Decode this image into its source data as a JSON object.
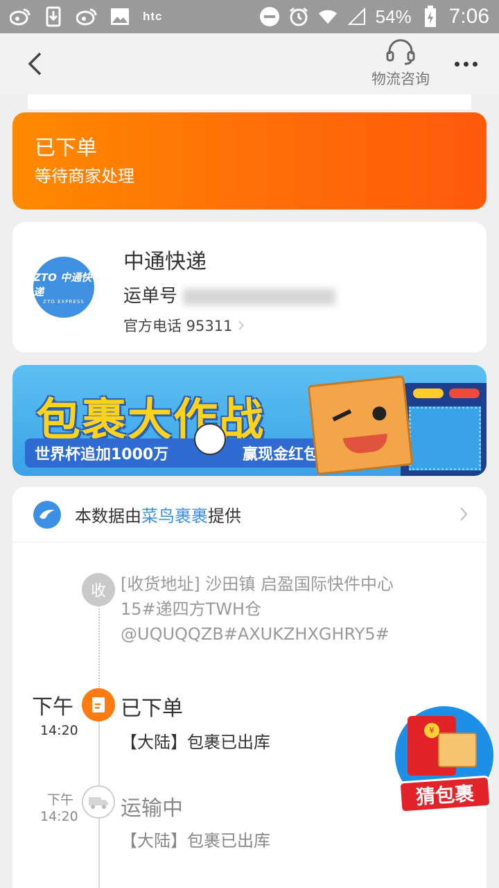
{
  "status_bar": {
    "battery_percent": "54%",
    "time": "7:06",
    "carrier_logo": "htc",
    "icons": [
      "weibo-icon",
      "download-icon",
      "weibo-icon",
      "image-icon",
      "htc-logo",
      "dnd-icon",
      "alarm-icon",
      "wifi-icon",
      "signal-icon",
      "battery-charging-icon"
    ]
  },
  "navbar": {
    "consult_label": "物流咨询"
  },
  "status_card": {
    "title": "已下单",
    "subtitle": "等待商家处理"
  },
  "courier": {
    "name": "中通快递",
    "waybill_label": "运单号",
    "phone_label": "官方电话 95311",
    "logo_text": "ZTO 中通快递",
    "logo_subtext": "ZTO EXPRESS"
  },
  "banner": {
    "title": "包裹大作战",
    "left_text": "世界杯追加1000万",
    "right_text": "赢现金红包"
  },
  "tracking": {
    "provider_prefix": "本数据由",
    "provider_name": "菜鸟裹裹",
    "provider_suffix": "提供",
    "receive_badge": "收",
    "address": "[收货地址]  沙田镇   启盈国际快件中心15#递四方TWH仓@UQUQQZB#AXUKZHXGHRY5#",
    "events": [
      {
        "time_period": "下午",
        "time": "14:20",
        "title": "已下单",
        "desc": "【大陆】包裹已出库"
      },
      {
        "time_period": "下午",
        "time": "14:20",
        "title": "运输中",
        "desc": "【大陆】包裹已出库"
      }
    ]
  },
  "floating": {
    "label": "猜包裹",
    "coin": "¥"
  },
  "colors": {
    "orange_start": "#ff8a00",
    "orange_end": "#ff5a0a",
    "link_blue": "#3b8fe5",
    "logo_blue": "#3f8fe3"
  }
}
